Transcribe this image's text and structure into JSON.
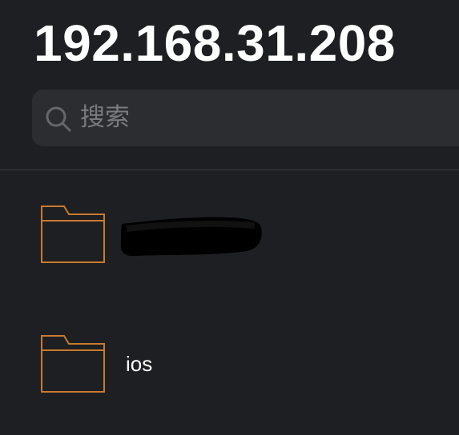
{
  "header": {
    "title": "192.168.31.208"
  },
  "search": {
    "placeholder": "搜索",
    "icon": "search-icon"
  },
  "colors": {
    "background": "#1e1f22",
    "search_bg": "#2c2d31",
    "folder_stroke": "#c77a2e",
    "placeholder": "#7a7b80"
  },
  "files": {
    "items": [
      {
        "label": "",
        "icon": "folder-icon",
        "redacted": true
      },
      {
        "label": "ios",
        "icon": "folder-icon",
        "redacted": false
      }
    ]
  }
}
